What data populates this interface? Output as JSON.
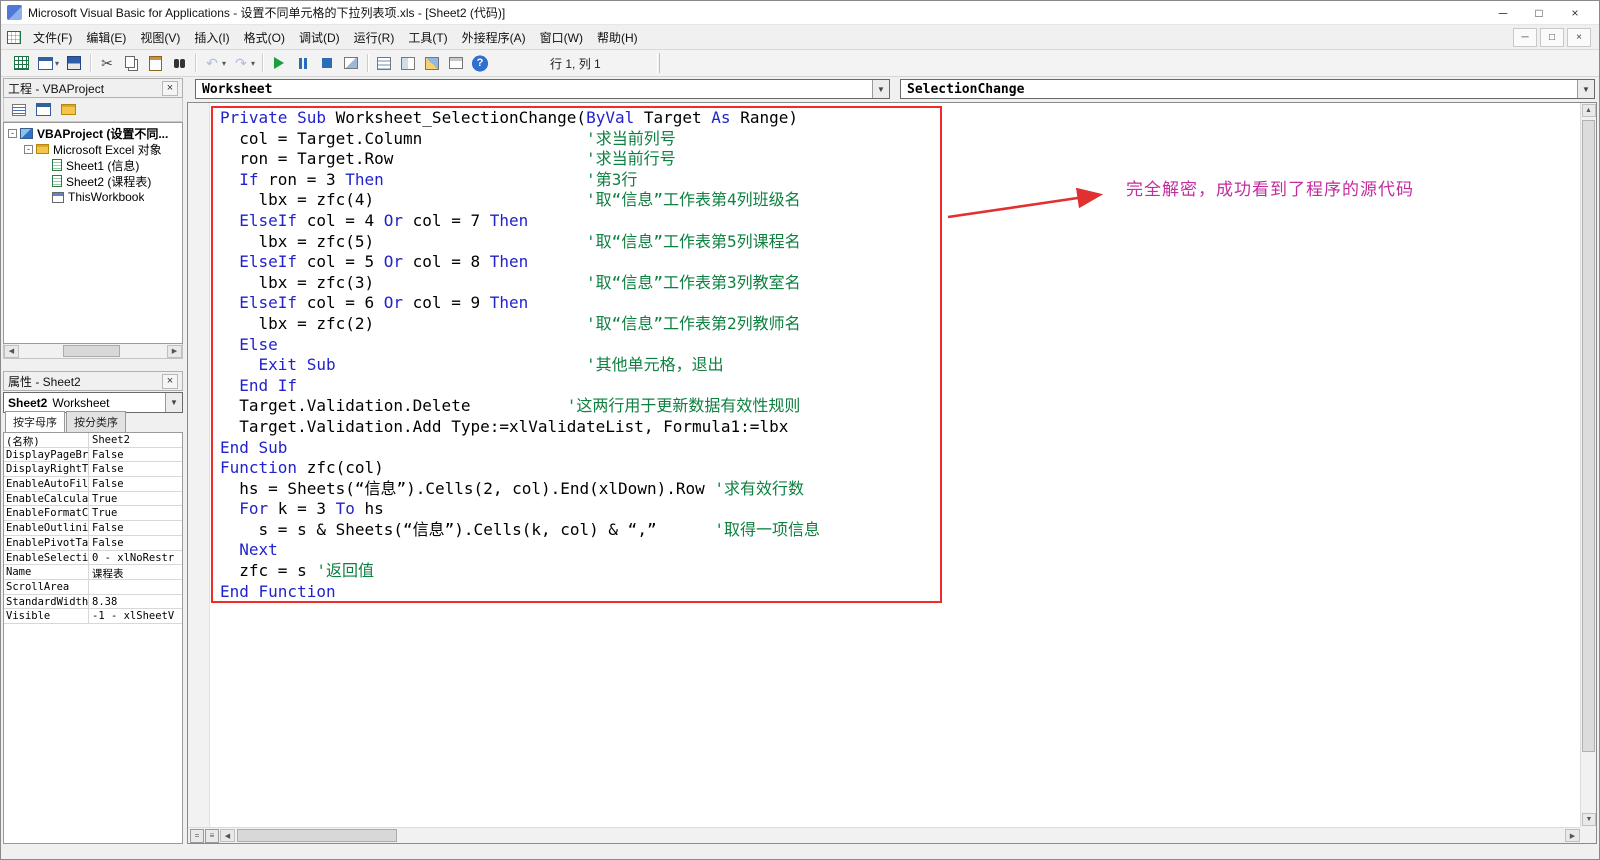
{
  "window": {
    "title": "Microsoft Visual Basic for Applications - 设置不同单元格的下拉列表项.xls - [Sheet2 (代码)]",
    "controls": {
      "minimize": "─",
      "maximize": "□",
      "close": "×"
    }
  },
  "menubar": {
    "items": [
      "文件(F)",
      "编辑(E)",
      "视图(V)",
      "插入(I)",
      "格式(O)",
      "调试(D)",
      "运行(R)",
      "工具(T)",
      "外接程序(A)",
      "窗口(W)",
      "帮助(H)"
    ],
    "controls": {
      "minimize": "─",
      "restore": "□",
      "close": "×"
    }
  },
  "toolbar": {
    "position": "行 1, 列 1",
    "icons": [
      {
        "name": "view-excel",
        "kind": "excel"
      },
      {
        "name": "insert-userform",
        "kind": "form",
        "dropdown": true
      },
      {
        "name": "save",
        "kind": "save"
      },
      {
        "kind": "sep"
      },
      {
        "name": "cut",
        "kind": "cut",
        "glyph": "✂"
      },
      {
        "name": "copy",
        "kind": "copy"
      },
      {
        "name": "paste",
        "kind": "paste"
      },
      {
        "name": "find",
        "kind": "find"
      },
      {
        "kind": "sep"
      },
      {
        "name": "undo",
        "kind": "undo",
        "glyph": "↶",
        "dropdown": true,
        "grayed": true
      },
      {
        "name": "redo",
        "kind": "redo",
        "glyph": "↷",
        "dropdown": true,
        "grayed": true
      },
      {
        "kind": "sep"
      },
      {
        "name": "run",
        "kind": "run"
      },
      {
        "name": "break",
        "kind": "break"
      },
      {
        "name": "reset",
        "kind": "reset"
      },
      {
        "name": "design-mode",
        "kind": "design"
      },
      {
        "kind": "sep"
      },
      {
        "name": "project-explorer",
        "kind": "projexp"
      },
      {
        "name": "properties-window",
        "kind": "propwin"
      },
      {
        "name": "object-browser",
        "kind": "objbrowser"
      },
      {
        "name": "toolbox",
        "kind": "toolbox"
      },
      {
        "name": "help",
        "kind": "help",
        "glyph": "?"
      }
    ]
  },
  "project": {
    "title": "工程 - VBAProject",
    "toolbar": [
      {
        "name": "view-code",
        "kind": "viewcode"
      },
      {
        "name": "view-object",
        "kind": "form"
      },
      {
        "name": "toggle-folders",
        "kind": "folder"
      }
    ],
    "tree": [
      {
        "label": "VBAProject (设置不同...",
        "indent": 0,
        "icon": "project",
        "expander": "-",
        "bold": true
      },
      {
        "label": "Microsoft Excel 对象",
        "indent": 1,
        "icon": "folder",
        "expander": "-"
      },
      {
        "label": "Sheet1 (信息)",
        "indent": 2,
        "icon": "sheet"
      },
      {
        "label": "Sheet2 (课程表)",
        "indent": 2,
        "icon": "sheet"
      },
      {
        "label": "ThisWorkbook",
        "indent": 2,
        "icon": "workbook"
      }
    ]
  },
  "properties": {
    "title": "属性 - Sheet2",
    "selector_name": "Sheet2",
    "selector_type": "Worksheet",
    "tabs": [
      "按字母序",
      "按分类序"
    ],
    "rows": [
      [
        "(名称)",
        "Sheet2"
      ],
      [
        "DisplayPageBre",
        "False"
      ],
      [
        "DisplayRightTo",
        "False"
      ],
      [
        "EnableAutoFilt",
        "False"
      ],
      [
        "EnableCalculat",
        "True"
      ],
      [
        "EnableFormatCo",
        "True"
      ],
      [
        "EnableOutlinin",
        "False"
      ],
      [
        "EnablePivotTab",
        "False"
      ],
      [
        "EnableSelectio",
        "0 - xlNoRestr"
      ],
      [
        "Name",
        "课程表"
      ],
      [
        "ScrollArea",
        ""
      ],
      [
        "StandardWidth",
        "8.38"
      ],
      [
        "Visible",
        "-1 - xlSheetV"
      ]
    ]
  },
  "editor": {
    "object_combo": "Worksheet",
    "event_combo": "SelectionChange",
    "annotation": "完全解密，成功看到了程序的源代码",
    "code": [
      [
        [
          "k",
          "Private Sub"
        ],
        [
          "n",
          " Worksheet_SelectionChange("
        ],
        [
          "k",
          "ByVal"
        ],
        [
          "n",
          " Target "
        ],
        [
          "k",
          "As"
        ],
        [
          "n",
          " Range)"
        ]
      ],
      [
        [
          "n",
          "  col = Target.Column"
        ],
        [
          "c",
          "                 '求当前列号"
        ]
      ],
      [
        [
          "n",
          "  ron = Target.Row"
        ],
        [
          "c",
          "                    '求当前行号"
        ]
      ],
      [
        [
          "n",
          "  "
        ],
        [
          "k",
          "If"
        ],
        [
          "n",
          " ron = 3 "
        ],
        [
          "k",
          "Then"
        ],
        [
          "c",
          "                     '第3行"
        ]
      ],
      [
        [
          "n",
          "    lbx = zfc(4)"
        ],
        [
          "c",
          "                      '取“信息”工作表第4列班级名"
        ]
      ],
      [
        [
          "n",
          "  "
        ],
        [
          "k",
          "ElseIf"
        ],
        [
          "n",
          " col = 4 "
        ],
        [
          "k",
          "Or"
        ],
        [
          "n",
          " col = 7 "
        ],
        [
          "k",
          "Then"
        ]
      ],
      [
        [
          "n",
          "    lbx = zfc(5)"
        ],
        [
          "c",
          "                      '取“信息”工作表第5列课程名"
        ]
      ],
      [
        [
          "n",
          "  "
        ],
        [
          "k",
          "ElseIf"
        ],
        [
          "n",
          " col = 5 "
        ],
        [
          "k",
          "Or"
        ],
        [
          "n",
          " col = 8 "
        ],
        [
          "k",
          "Then"
        ]
      ],
      [
        [
          "n",
          "    lbx = zfc(3)"
        ],
        [
          "c",
          "                      '取“信息”工作表第3列教室名"
        ]
      ],
      [
        [
          "n",
          "  "
        ],
        [
          "k",
          "ElseIf"
        ],
        [
          "n",
          " col = 6 "
        ],
        [
          "k",
          "Or"
        ],
        [
          "n",
          " col = 9 "
        ],
        [
          "k",
          "Then"
        ]
      ],
      [
        [
          "n",
          "    lbx = zfc(2)"
        ],
        [
          "c",
          "                      '取“信息”工作表第2列教师名"
        ]
      ],
      [
        [
          "n",
          "  "
        ],
        [
          "k",
          "Else"
        ]
      ],
      [
        [
          "n",
          "    "
        ],
        [
          "k",
          "Exit Sub"
        ],
        [
          "c",
          "                          '其他单元格，退出"
        ]
      ],
      [
        [
          "n",
          "  "
        ],
        [
          "k",
          "End If"
        ]
      ],
      [
        [
          "n",
          "  Target.Validation.Delete"
        ],
        [
          "c",
          "          '这两行用于更新数据有效性规则"
        ]
      ],
      [
        [
          "n",
          "  Target.Validation.Add Type:=xlValidateList, Formula1:=lbx"
        ]
      ],
      [
        [
          "k",
          "End Sub"
        ]
      ],
      [
        [
          "k",
          "Function"
        ],
        [
          "n",
          " zfc(col)"
        ]
      ],
      [
        [
          "n",
          "  hs = Sheets(“信息”).Cells(2, col).End(xlDown).Row "
        ],
        [
          "c",
          "'求有效行数"
        ]
      ],
      [
        [
          "n",
          "  "
        ],
        [
          "k",
          "For"
        ],
        [
          "n",
          " k = 3 "
        ],
        [
          "k",
          "To"
        ],
        [
          "n",
          " hs"
        ]
      ],
      [
        [
          "n",
          "    s = s & Sheets(“信息”).Cells(k, col) & “,”      "
        ],
        [
          "c",
          "'取得一项信息"
        ]
      ],
      [
        [
          "n",
          "  "
        ],
        [
          "k",
          "Next"
        ]
      ],
      [
        [
          "n",
          "  zfc = s "
        ],
        [
          "c",
          "'返回值"
        ]
      ],
      [
        [
          "k",
          "End Function"
        ]
      ]
    ]
  }
}
